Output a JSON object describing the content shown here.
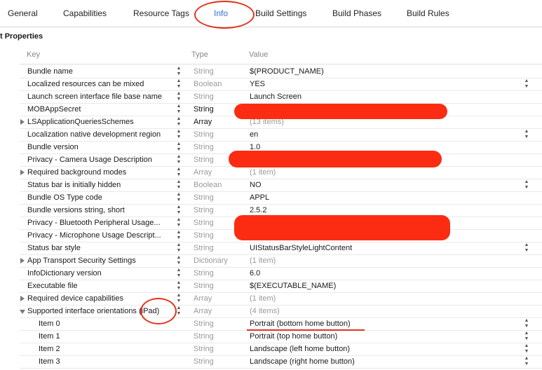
{
  "tabs": [
    {
      "label": "General"
    },
    {
      "label": "Capabilities"
    },
    {
      "label": "Resource Tags"
    },
    {
      "label": "Info"
    },
    {
      "label": "Build Settings"
    },
    {
      "label": "Build Phases"
    },
    {
      "label": "Build Rules"
    }
  ],
  "active_tab": "Info",
  "section_title": "t Properties",
  "headers": {
    "key": "Key",
    "type": "Type",
    "value": "Value"
  },
  "rows": [
    {
      "key": "Bundle name",
      "type": "String",
      "value": "$(PRODUCT_NAME)"
    },
    {
      "key": "Localized resources can be mixed",
      "type": "Boolean",
      "value": "YES"
    },
    {
      "key": "Launch screen interface file base name",
      "type": "String",
      "value": "Launch Screen"
    },
    {
      "key": "MOBAppSecret",
      "type": "String",
      "value": ""
    },
    {
      "key": "LSApplicationQueriesSchemes",
      "type": "Array",
      "value": "(13 items)"
    },
    {
      "key": "Localization native development region",
      "type": "String",
      "value": "en"
    },
    {
      "key": "Bundle version",
      "type": "String",
      "value": "1.0"
    },
    {
      "key": "Privacy - Camera Usage Description",
      "type": "String",
      "value": ""
    },
    {
      "key": "Required background modes",
      "type": "Array",
      "value": "(1 item)"
    },
    {
      "key": "Status bar is initially hidden",
      "type": "Boolean",
      "value": "NO"
    },
    {
      "key": "Bundle OS Type code",
      "type": "String",
      "value": "APPL"
    },
    {
      "key": "Bundle versions string, short",
      "type": "String",
      "value": "2.5.2"
    },
    {
      "key": "Privacy - Bluetooth Peripheral Usage...",
      "type": "String",
      "value": ""
    },
    {
      "key": "Privacy - Microphone Usage Descript...",
      "type": "String",
      "value": ""
    },
    {
      "key": "Status bar style",
      "type": "String",
      "value": "UIStatusBarStyleLightContent"
    },
    {
      "key": "App Transport Security Settings",
      "type": "Dictionary",
      "value": "(1 item)"
    },
    {
      "key": "InfoDictionary version",
      "type": "String",
      "value": "6.0"
    },
    {
      "key": "Executable file",
      "type": "String",
      "value": "$(EXECUTABLE_NAME)"
    },
    {
      "key": "Required device capabilities",
      "type": "Array",
      "value": "(1 item)"
    },
    {
      "key": "Supported interface orientations (iPad)",
      "type": "Array",
      "value": "(4 items)"
    },
    {
      "key": "Item 0",
      "type": "String",
      "value": "Portrait (bottom home button)"
    },
    {
      "key": "Item 1",
      "type": "String",
      "value": "Portrait (top home button)"
    },
    {
      "key": "Item 2",
      "type": "String",
      "value": "Landscape (left home button)"
    },
    {
      "key": "Item 3",
      "type": "String",
      "value": "Landscape (right home button)"
    }
  ],
  "colors": {
    "accent": "#2f6fd6",
    "annotation_red": "#e0331d",
    "redaction_red": "#fb2c12"
  },
  "icons": {
    "updown": "up-down-stepper-icon",
    "disclosure": "disclosure-triangle-icon"
  }
}
